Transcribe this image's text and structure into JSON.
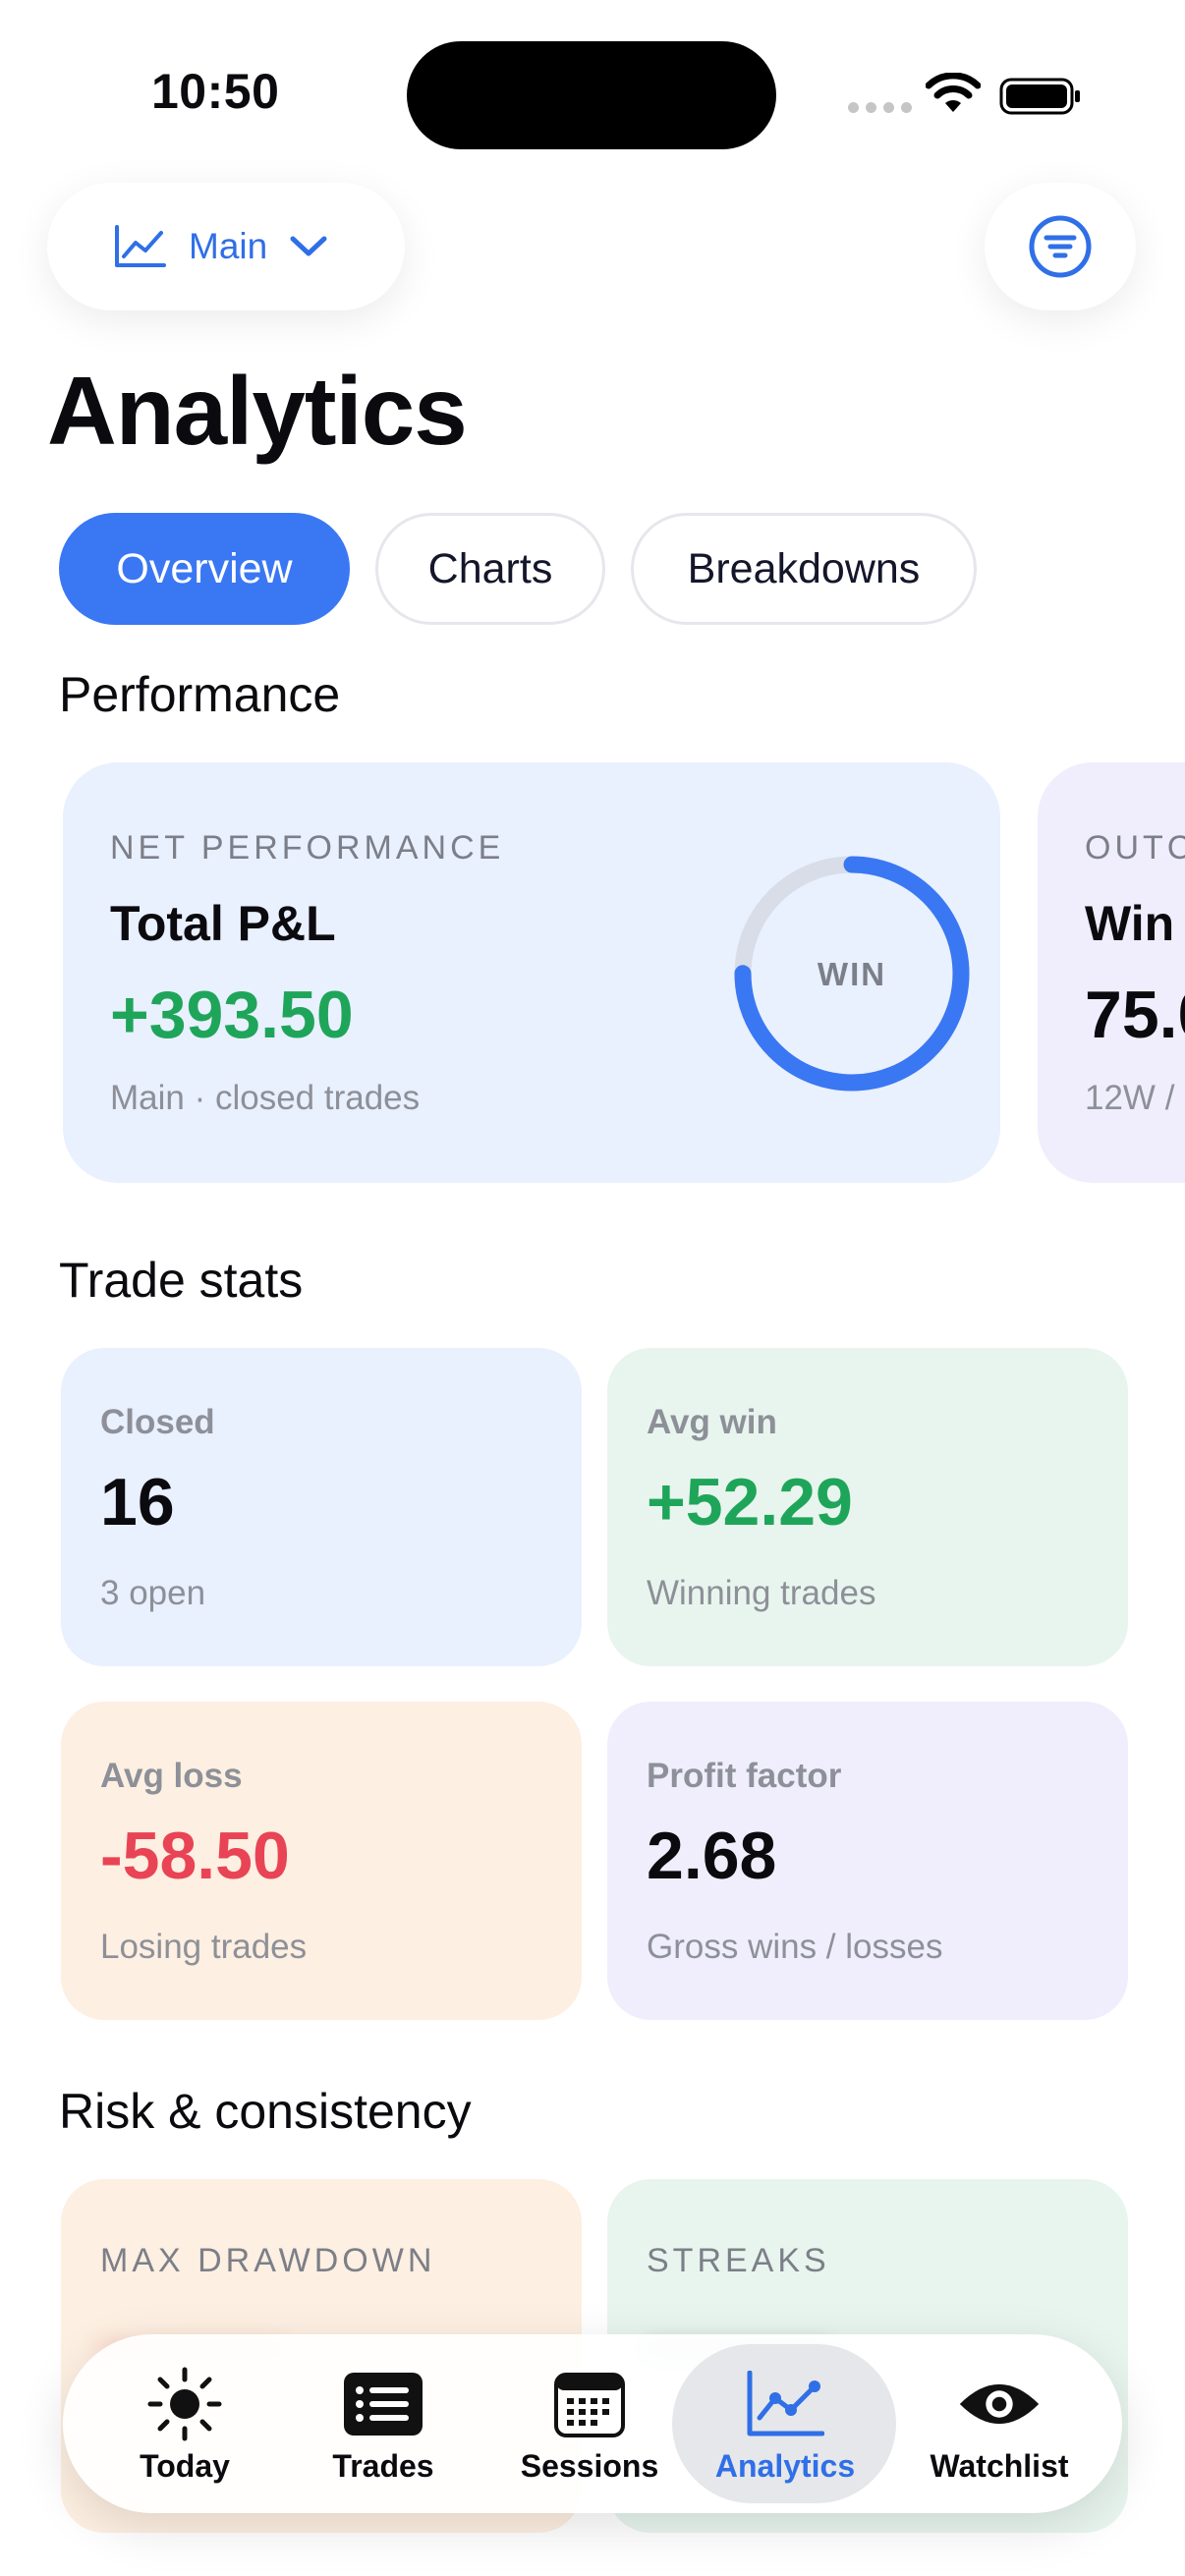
{
  "status_bar": {
    "time": "10:50"
  },
  "header": {
    "account_label": "Main",
    "title": "Analytics",
    "account_icon": "trend-chart-icon",
    "filter_icon": "filter-lines-icon"
  },
  "tabs": [
    {
      "label": "Overview",
      "active": true
    },
    {
      "label": "Charts",
      "active": false
    },
    {
      "label": "Breakdowns",
      "active": false
    }
  ],
  "performance": {
    "section_title": "Performance",
    "main_card": {
      "eyebrow": "NET PERFORMANCE",
      "name": "Total P&L",
      "value": "+393.50",
      "subtitle": "Main · closed trades",
      "ring_label": "WIN",
      "ring_fraction": 0.75
    },
    "next_card": {
      "eyebrow": "OUTC",
      "name": "Win",
      "value": "75.0",
      "subtitle": "12W /"
    }
  },
  "trade_stats": {
    "section_title": "Trade stats",
    "cards": [
      {
        "label": "Closed",
        "value": "16",
        "hint": "3 open"
      },
      {
        "label": "Avg win",
        "value": "+52.29",
        "hint": "Winning trades"
      },
      {
        "label": "Avg loss",
        "value": "-58.50",
        "hint": "Losing trades"
      },
      {
        "label": "Profit factor",
        "value": "2.68",
        "hint": "Gross wins / losses"
      }
    ]
  },
  "risk": {
    "section_title": "Risk & consistency",
    "cards": [
      {
        "eyebrow": "MAX DRAWDOWN"
      },
      {
        "eyebrow": "STREAKS"
      }
    ]
  },
  "tabbar": [
    {
      "label": "Today",
      "icon": "sun-icon"
    },
    {
      "label": "Trades",
      "icon": "list-icon"
    },
    {
      "label": "Sessions",
      "icon": "calendar-icon"
    },
    {
      "label": "Analytics",
      "icon": "chart-line-icon",
      "active": true
    },
    {
      "label": "Watchlist",
      "icon": "eye-icon"
    }
  ],
  "colors": {
    "accent": "#3a77f3",
    "positive": "#1fa55a",
    "negative": "#e84455"
  }
}
